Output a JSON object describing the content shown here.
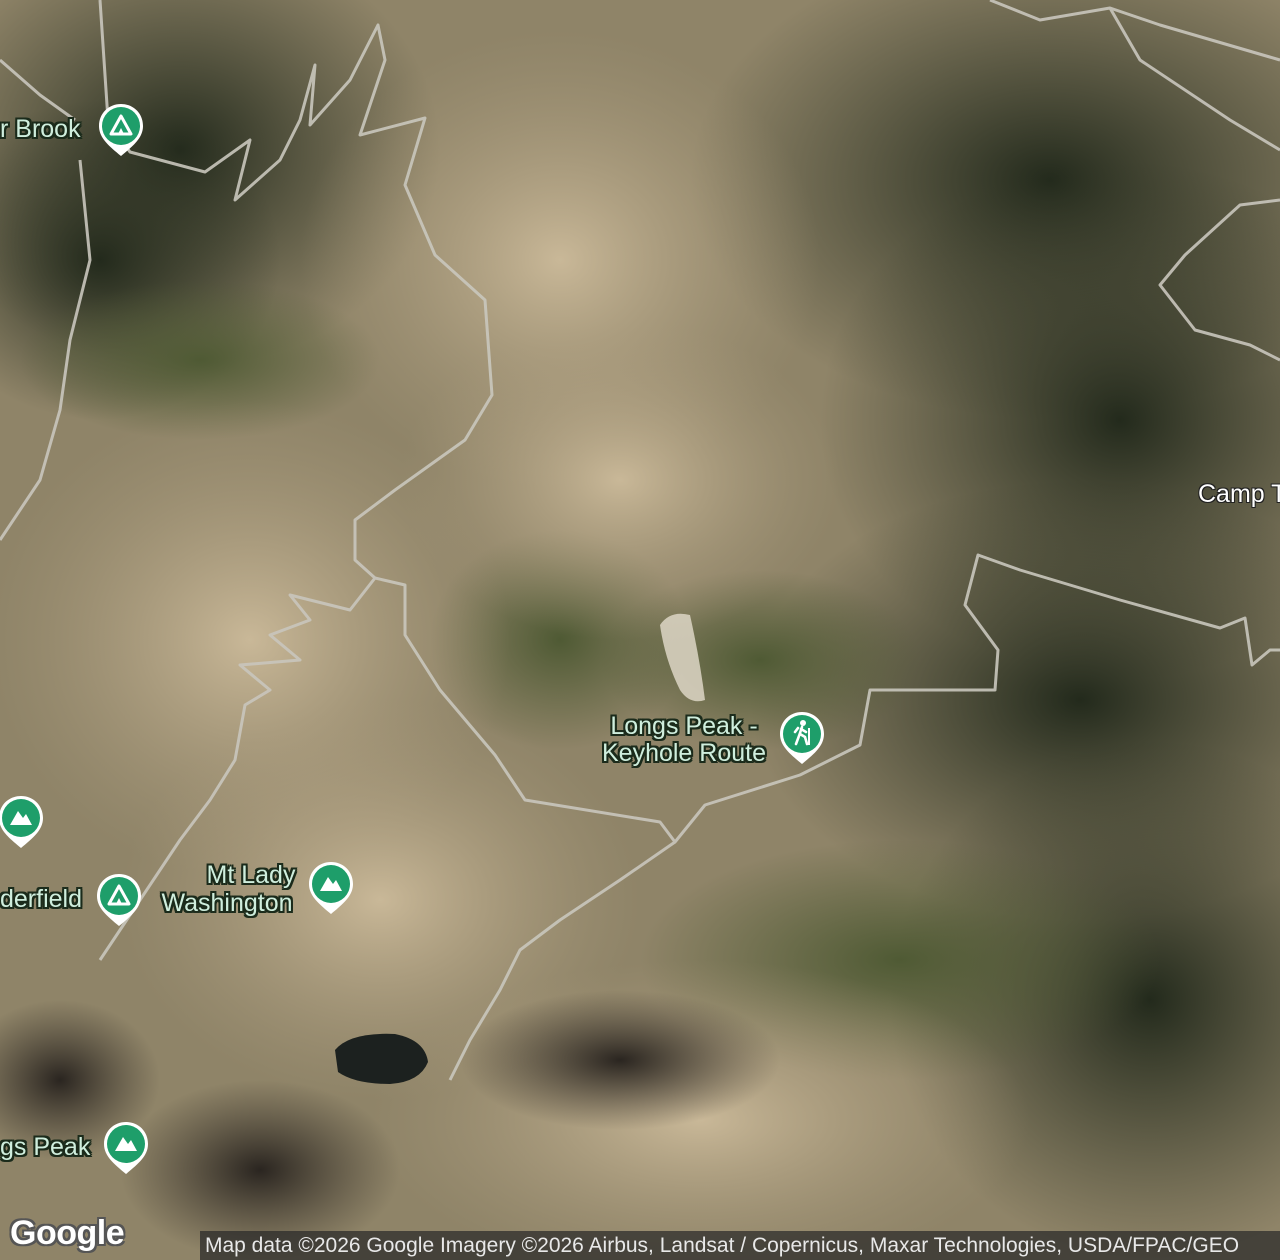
{
  "map": {
    "places": [
      {
        "id": "brook",
        "label": "r Brook",
        "icon": "campground-icon"
      },
      {
        "id": "camp",
        "label": "Camp T",
        "icon": ""
      },
      {
        "id": "keyhole",
        "label_line1": "Longs Peak -",
        "label_line2": "Keyhole Route",
        "icon": "hiking-icon"
      },
      {
        "id": "unnamed-left",
        "label": "",
        "icon": "mountain-icon"
      },
      {
        "id": "chasm",
        "label": "derfield",
        "icon": "campground-icon"
      },
      {
        "id": "ladywashington",
        "label_line1": "Mt Lady",
        "label_line2": "Washington",
        "icon": "mountain-icon"
      },
      {
        "id": "longspeak",
        "label": "gs Peak",
        "icon": "mountain-icon"
      }
    ],
    "pin_color": "#1e9e6a",
    "label_color": "#cfeedd",
    "trail_color": "#c9c6bd"
  },
  "footer": {
    "logo": "Google",
    "attribution": "Map data ©2026 Google Imagery ©2026 Airbus, Landsat / Copernicus, Maxar Technologies, USDA/FPAC/GEO"
  }
}
